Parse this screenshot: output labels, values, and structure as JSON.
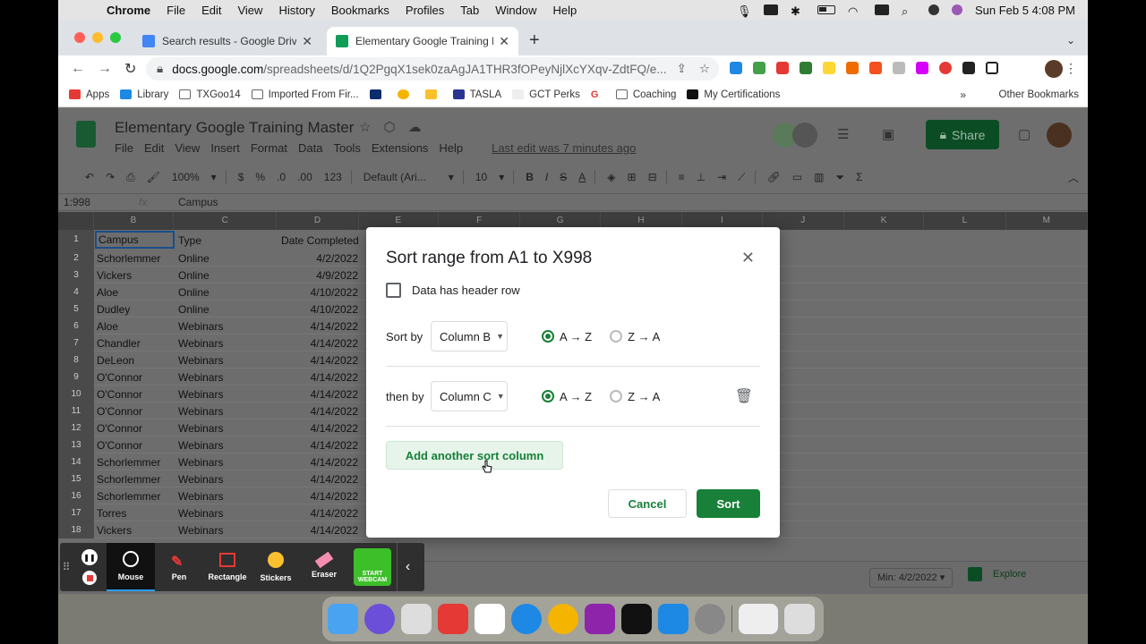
{
  "menubar": {
    "app_name": "Chrome",
    "items": [
      "File",
      "Edit",
      "View",
      "History",
      "Bookmarks",
      "Profiles",
      "Tab",
      "Window",
      "Help"
    ],
    "clock": "Sun Feb 5  4:08 PM"
  },
  "browser": {
    "tabs": [
      {
        "title": "Search results - Google Drive",
        "color": "#4285f4"
      },
      {
        "title": "Elementary Google Training Ma",
        "color": "#0f9d58"
      }
    ],
    "url_host": "docs.google.com",
    "url_path": "/spreadsheets/d/1Q2PgqX1sek0zaAgJA1THR3fOPeyNjlXcYXqv-ZdtFQ/e...",
    "bookmarks": [
      "Apps",
      "Library",
      "TXGoo14",
      "Imported From Fir...",
      "",
      "",
      "",
      "TASLA",
      "GCT Perks",
      "",
      "Coaching",
      "My Certifications"
    ],
    "bookmarks_more": "»",
    "other_bookmarks": "Other Bookmarks"
  },
  "sheets": {
    "doc_title": "Elementary Google Training Master",
    "menu": [
      "File",
      "Edit",
      "View",
      "Insert",
      "Format",
      "Data",
      "Tools",
      "Extensions",
      "Help"
    ],
    "last_edit": "Last edit was 7 minutes ago",
    "share_label": "Share",
    "toolbar": {
      "zoom": "100%",
      "currency": "$",
      "percent": "%",
      "dec_less": ".0",
      "dec_more": ".00",
      "num_format": "123",
      "font": "Default (Ari...",
      "font_size": "10",
      "bold": "B",
      "italic": "I",
      "strike": "S",
      "text_color": "A"
    },
    "name_box": "1:998",
    "formula": "Campus",
    "columns": [
      "B",
      "C",
      "D",
      "E",
      "F",
      "G",
      "H",
      "I",
      "J",
      "K",
      "L",
      "M"
    ],
    "header_row": [
      "Campus",
      "Type",
      "Date Completed"
    ],
    "rows": [
      {
        "n": "2",
        "campus": "Schorlemmer",
        "type": "Online",
        "date": "4/2/2022"
      },
      {
        "n": "3",
        "campus": "Vickers",
        "type": "Online",
        "date": "4/9/2022"
      },
      {
        "n": "4",
        "campus": "Aloe",
        "type": "Online",
        "date": "4/10/2022"
      },
      {
        "n": "5",
        "campus": "Dudley",
        "type": "Online",
        "date": "4/10/2022"
      },
      {
        "n": "6",
        "campus": "Aloe",
        "type": "Webinars",
        "date": "4/14/2022"
      },
      {
        "n": "7",
        "campus": "Chandler",
        "type": "Webinars",
        "date": "4/14/2022"
      },
      {
        "n": "8",
        "campus": "DeLeon",
        "type": "Webinars",
        "date": "4/14/2022"
      },
      {
        "n": "9",
        "campus": "O'Connor",
        "type": "Webinars",
        "date": "4/14/2022"
      },
      {
        "n": "10",
        "campus": "O'Connor",
        "type": "Webinars",
        "date": "4/14/2022"
      },
      {
        "n": "11",
        "campus": "O'Connor",
        "type": "Webinars",
        "date": "4/14/2022"
      },
      {
        "n": "12",
        "campus": "O'Connor",
        "type": "Webinars",
        "date": "4/14/2022"
      },
      {
        "n": "13",
        "campus": "O'Connor",
        "type": "Webinars",
        "date": "4/14/2022"
      },
      {
        "n": "14",
        "campus": "Schorlemmer",
        "type": "Webinars",
        "date": "4/14/2022"
      },
      {
        "n": "15",
        "campus": "Schorlemmer",
        "type": "Webinars",
        "date": "4/14/2022"
      },
      {
        "n": "16",
        "campus": "Schorlemmer",
        "type": "Webinars",
        "date": "4/14/2022"
      },
      {
        "n": "17",
        "campus": "Torres",
        "type": "Webinars",
        "date": "4/14/2022"
      },
      {
        "n": "18",
        "campus": "Vickers",
        "type": "Webinars",
        "date": "4/14/2022"
      }
    ],
    "min_summary": "Min: 4/2/2022",
    "explore_label": "Explore"
  },
  "dialog": {
    "title": "Sort range from A1 to X998",
    "header_row_label": "Data has header row",
    "header_row_checked": false,
    "sort_by_label": "Sort by",
    "sort_by_column": "Column B",
    "then_by_label": "then by",
    "then_by_column": "Column C",
    "asc_label": "A → Z",
    "desc_label": "Z → A",
    "add_column_label": "Add another sort column",
    "cancel_label": "Cancel",
    "sort_label": "Sort",
    "accent": "#188038"
  },
  "recorder": {
    "tools": [
      "Mouse",
      "Pen",
      "Rectangle",
      "Stickers",
      "Eraser"
    ],
    "webcam_label": "START WEBCAM"
  }
}
